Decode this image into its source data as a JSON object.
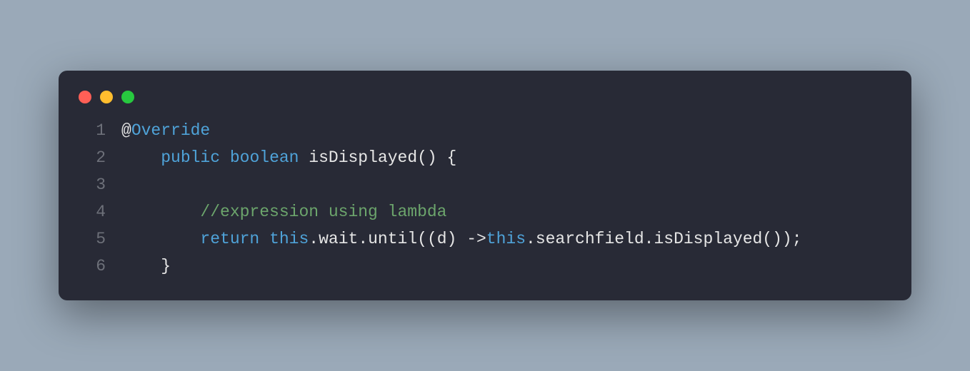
{
  "window": {
    "dots": [
      "red",
      "yellow",
      "green"
    ]
  },
  "code": {
    "lines": [
      {
        "num": "1",
        "indent": "",
        "tokens": [
          {
            "cls": "c-annotation-at",
            "text": "@"
          },
          {
            "cls": "c-annotation",
            "text": "Override"
          }
        ]
      },
      {
        "num": "2",
        "indent": "    ",
        "tokens": [
          {
            "cls": "c-keyword",
            "text": "public"
          },
          {
            "cls": "c-default",
            "text": " "
          },
          {
            "cls": "c-type",
            "text": "boolean"
          },
          {
            "cls": "c-default",
            "text": " "
          },
          {
            "cls": "c-method",
            "text": "isDisplayed"
          },
          {
            "cls": "c-paren",
            "text": "()"
          },
          {
            "cls": "c-default",
            "text": " "
          },
          {
            "cls": "c-brace",
            "text": "{"
          }
        ]
      },
      {
        "num": "3",
        "indent": "",
        "tokens": []
      },
      {
        "num": "4",
        "indent": "        ",
        "tokens": [
          {
            "cls": "c-comment",
            "text": "//expression using lambda"
          }
        ]
      },
      {
        "num": "5",
        "indent": "        ",
        "tokens": [
          {
            "cls": "c-return",
            "text": "return"
          },
          {
            "cls": "c-default",
            "text": " "
          },
          {
            "cls": "c-this",
            "text": "this"
          },
          {
            "cls": "c-dot",
            "text": "."
          },
          {
            "cls": "c-prop",
            "text": "wait"
          },
          {
            "cls": "c-dot",
            "text": "."
          },
          {
            "cls": "c-prop",
            "text": "until"
          },
          {
            "cls": "c-paren",
            "text": "(("
          },
          {
            "cls": "c-default",
            "text": "d"
          },
          {
            "cls": "c-paren",
            "text": ")"
          },
          {
            "cls": "c-default",
            "text": " "
          },
          {
            "cls": "c-arrow",
            "text": "->"
          },
          {
            "cls": "c-this",
            "text": "this"
          },
          {
            "cls": "c-dot",
            "text": "."
          },
          {
            "cls": "c-prop",
            "text": "searchfield"
          },
          {
            "cls": "c-dot",
            "text": "."
          },
          {
            "cls": "c-prop",
            "text": "isDisplayed"
          },
          {
            "cls": "c-paren",
            "text": "())"
          },
          {
            "cls": "c-default",
            "text": ";"
          }
        ]
      },
      {
        "num": "6",
        "indent": "    ",
        "tokens": [
          {
            "cls": "c-brace",
            "text": "}"
          }
        ]
      }
    ]
  }
}
